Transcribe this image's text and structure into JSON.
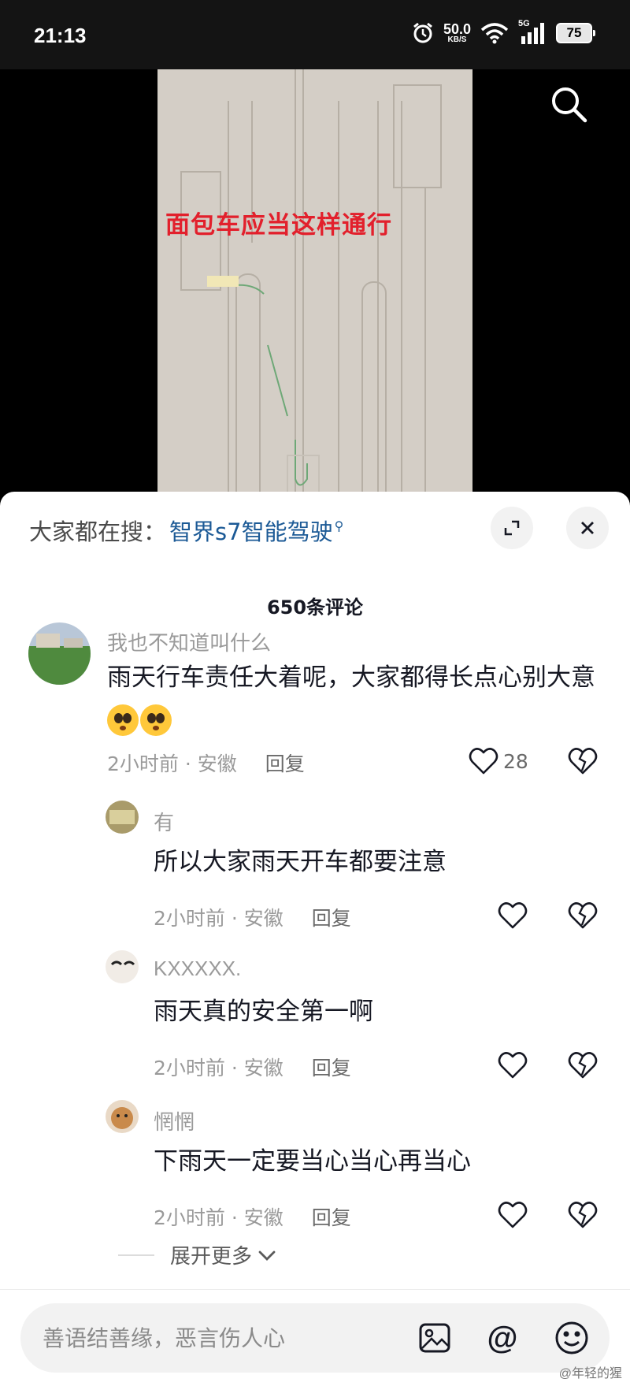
{
  "status_bar": {
    "time": "21:13",
    "net_speed_value": "50.0",
    "net_speed_unit": "KB/S",
    "network_type": "5G",
    "battery": "75"
  },
  "video": {
    "caption": "面包车应当这样通行"
  },
  "sheet": {
    "hot_search_label": "大家都在搜：",
    "hot_search_term": "智界s7智能驾驶",
    "comment_count": "650条评论"
  },
  "comments": [
    {
      "username": "我也不知道叫什么",
      "text": "雨天行车责任大着呢，大家都得长点心别大意",
      "emoji_count": 2,
      "time_location": "2小时前 · 安徽",
      "reply_label": "回复",
      "likes": "28"
    }
  ],
  "replies": [
    {
      "username": "有",
      "text": "所以大家雨天开车都要注意",
      "time_location": "2小时前 · 安徽",
      "reply_label": "回复"
    },
    {
      "username": "KXXXXX.",
      "text": "雨天真的安全第一啊",
      "time_location": "2小时前 · 安徽",
      "reply_label": "回复"
    },
    {
      "username": "惘惘",
      "text": "下雨天一定要当心当心再当心",
      "time_location": "2小时前 · 安徽",
      "reply_label": "回复"
    }
  ],
  "expand_more": "展开更多",
  "input": {
    "placeholder": "善语结善缘，恶言伤人心"
  },
  "watermark": "@年轻的猩",
  "colors": {
    "hot_search_term": "#1c5a96",
    "caption": "#e2202c",
    "status_bar": "#141414"
  }
}
